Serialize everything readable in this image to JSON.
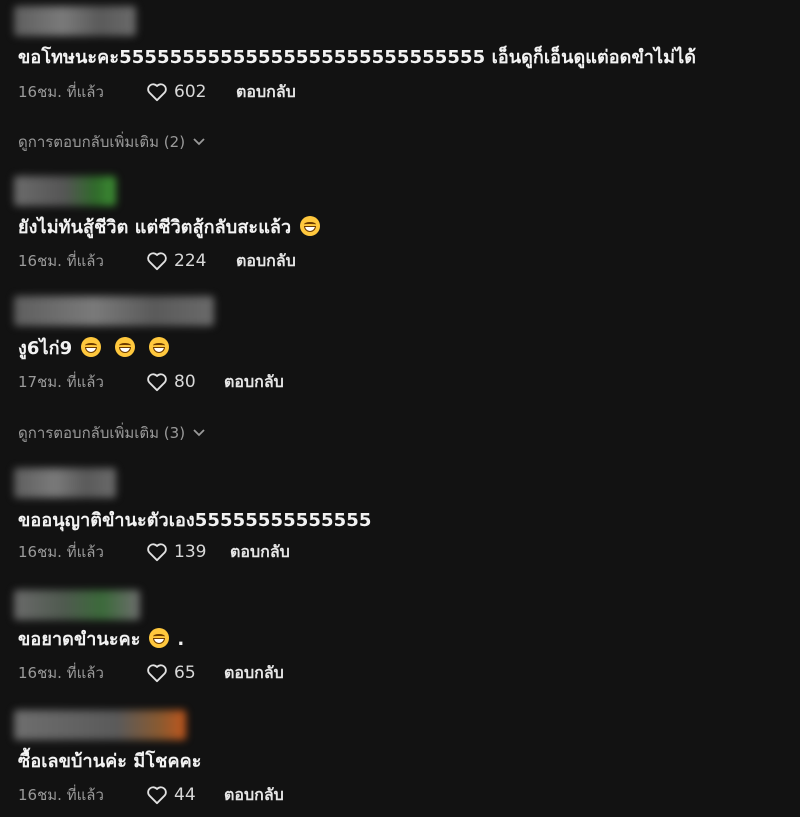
{
  "comments": [
    {
      "text": "ขอโทษนะคะ55555555555555555555555555555 เอ็นดูก็เอ็นดูแต่อดขำไม่ได้",
      "time": "16ชม. ที่แล้ว",
      "likes": "602",
      "reply_label": "ตอบกลับ",
      "more_replies": "ดูการตอบกลับเพิ่มเติม (2)"
    },
    {
      "text": "ยังไม่ทันสู้ชีวิต แต่ชีวิตสู้กลับสะแล้ว",
      "time": "16ชม. ที่แล้ว",
      "likes": "224",
      "reply_label": "ตอบกลับ"
    },
    {
      "text": "งู6ไก่9",
      "time": "17ชม. ที่แล้ว",
      "likes": "80",
      "reply_label": "ตอบกลับ",
      "more_replies": "ดูการตอบกลับเพิ่มเติม (3)"
    },
    {
      "text": "ขออนุญาติขำนะตัวเอง55555555555555",
      "time": "16ชม. ที่แล้ว",
      "likes": "139",
      "reply_label": "ตอบกลับ"
    },
    {
      "text": "ขอยาดขำนะคะ",
      "text_suffix": ".",
      "time": "16ชม. ที่แล้ว",
      "likes": "65",
      "reply_label": "ตอบกลับ"
    },
    {
      "text": "ซื้อเลขบ้านค่ะ มีโชคคะ",
      "time": "16ชม. ที่แล้ว",
      "likes": "44",
      "reply_label": "ตอบกลับ"
    }
  ],
  "colors": {
    "background": "#121212",
    "text": "#f2f2f2",
    "muted": "#9a9a9a"
  },
  "icons": {
    "like": "heart-outline-icon",
    "expand": "chevron-down-icon",
    "emoji": "grinning-squinting-face-emoji"
  }
}
